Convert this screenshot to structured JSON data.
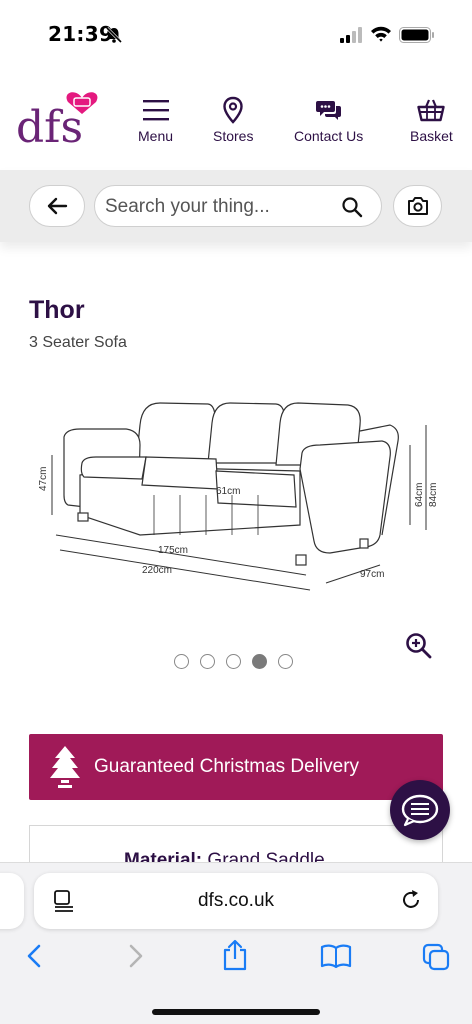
{
  "status_bar": {
    "time": "21:39"
  },
  "header": {
    "logo_text": "dfs",
    "nav": [
      {
        "label": "Menu",
        "icon": "menu-icon"
      },
      {
        "label": "Stores",
        "icon": "location-pin-icon"
      },
      {
        "label": "Contact Us",
        "icon": "chat-bubbles-icon"
      },
      {
        "label": "Basket",
        "icon": "basket-icon"
      }
    ]
  },
  "search": {
    "placeholder": "Search your thing..."
  },
  "product": {
    "title": "Thor",
    "subtitle": "3 Seater Sofa",
    "dimensions": {
      "seat_height": "47cm",
      "seat_depth": "61cm",
      "seat_width": "175cm",
      "overall_width": "220cm",
      "arm_height": "64cm",
      "overall_height": "84cm",
      "overall_depth": "97cm"
    },
    "carousel": {
      "total": 5,
      "active_index": 4
    }
  },
  "banner": {
    "text": "Guaranteed Christmas Delivery"
  },
  "material": {
    "label": "Material:",
    "value": "Grand Saddle"
  },
  "browser": {
    "url": "dfs.co.uk"
  },
  "colors": {
    "brand_purple": "#2d1045",
    "banner_magenta": "#a01a58",
    "ios_blue": "#1a7cf5"
  }
}
